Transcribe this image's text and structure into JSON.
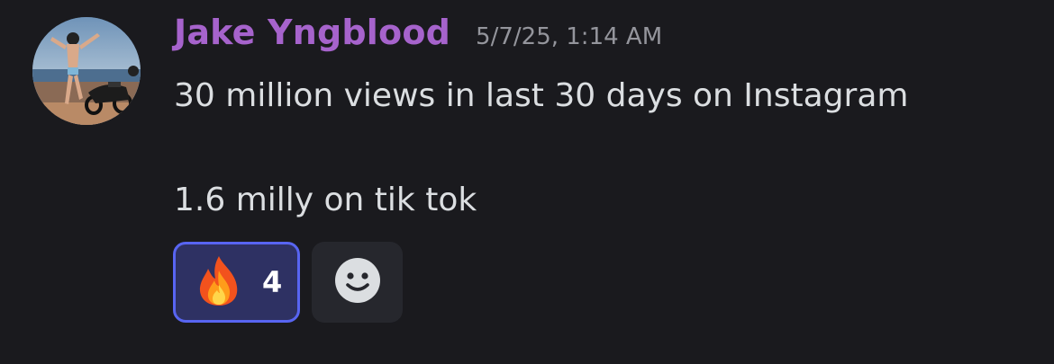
{
  "message": {
    "author": "Jake Yngblood",
    "timestamp": "5/7/25, 1:14 AM",
    "lines": [
      "30 million views in last 30 days on Instagram",
      "",
      "1.6 milly on tik tok"
    ]
  },
  "reactions": [
    {
      "emoji_icon": "fire-icon",
      "count": "4",
      "active": true
    }
  ],
  "add_reaction_icon": "smiley-face-icon",
  "colors": {
    "background": "#1a1a1e",
    "username": "#a663cc",
    "timestamp": "#94959c",
    "text": "#dbdee1",
    "reaction_active_bg": "#2e3163",
    "reaction_active_border": "#5865f2",
    "add_reaction_bg": "#26272d"
  }
}
